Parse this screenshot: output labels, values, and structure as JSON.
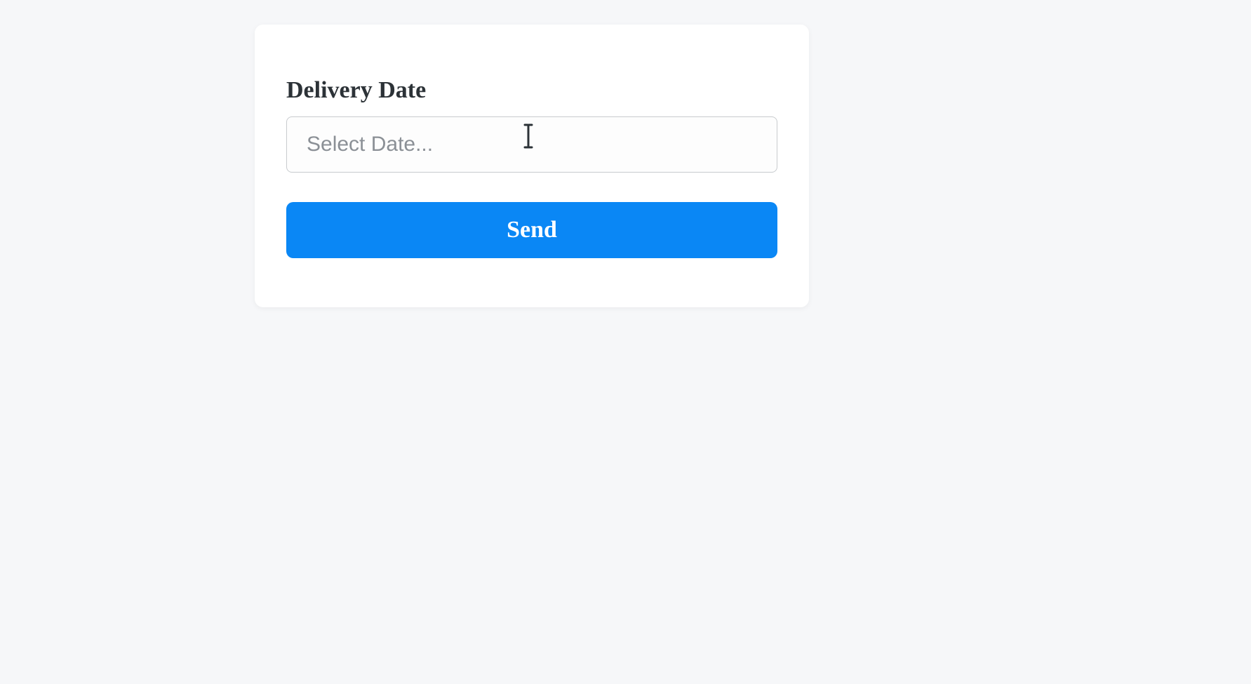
{
  "form": {
    "date_label": "Delivery Date",
    "date_placeholder": "Select Date...",
    "date_value": "",
    "submit_label": "Send"
  }
}
